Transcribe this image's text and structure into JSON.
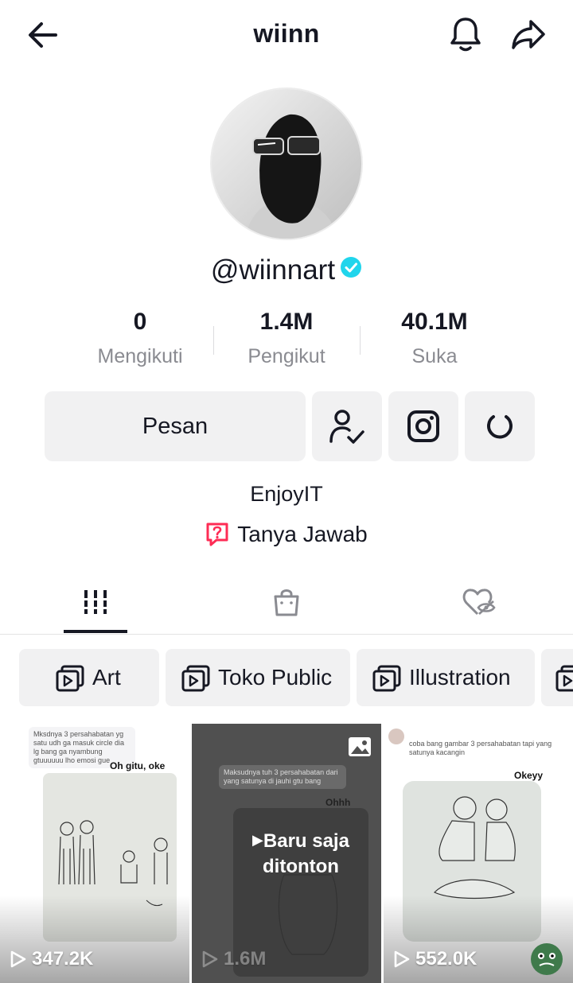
{
  "header": {
    "title": "wiinn",
    "back_icon": "arrow-left-icon",
    "bell_icon": "bell-icon",
    "share_icon": "share-arrow-icon"
  },
  "profile": {
    "handle": "@wiinnart",
    "verified": true,
    "verified_color": "#20D5EC",
    "bio": "EnjoyIT",
    "qa_label": "Tanya Jawab",
    "qa_color": "#FE2C55"
  },
  "stats": [
    {
      "value": "0",
      "label": "Mengikuti"
    },
    {
      "value": "1.4M",
      "label": "Pengikut"
    },
    {
      "value": "40.1M",
      "label": "Suka"
    }
  ],
  "actions": {
    "message_label": "Pesan",
    "following_icon": "user-check-icon",
    "instagram_icon": "instagram-icon",
    "sync_icon": "refresh-icon"
  },
  "tabs": [
    {
      "icon": "videos-grid-icon",
      "active": true
    },
    {
      "icon": "shopping-bag-icon",
      "active": false
    },
    {
      "icon": "liked-hidden-icon",
      "active": false
    }
  ],
  "playlists": [
    {
      "label": "Art"
    },
    {
      "label": "Toko Public"
    },
    {
      "label": "Illustration"
    }
  ],
  "videos": [
    {
      "views": "347.2K",
      "comment": "Mksdnya 3 persahabatan yg satu udh ga masuk circle dia lg bang ga nyambung gtuuuuuu lho emosi gue",
      "reply": "Oh gitu, oke"
    },
    {
      "views": "1.6M",
      "comment": "Maksudnya tuh 3 persahabatan dari yang satunya di jauhi gtu bang",
      "reply": "Ohhh",
      "watched_label": "Baru saja ditonton",
      "badge_icon": "image-icon"
    },
    {
      "views": "552.0K",
      "comment": "coba bang gambar 3 persahabatan tapi yang satunya kacangin",
      "reply": "Okeyy"
    }
  ]
}
